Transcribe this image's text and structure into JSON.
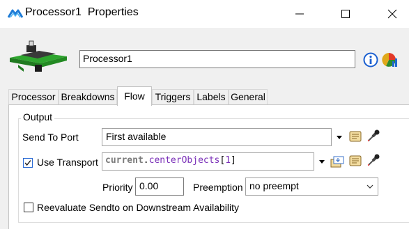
{
  "window": {
    "title": "Processor1  Properties",
    "icon": "flexsim-icon"
  },
  "header": {
    "object_name": "Processor1",
    "info_icon": "info-icon",
    "stats_icon": "statistics-icon"
  },
  "tabs": [
    {
      "label": "Processor",
      "active": false
    },
    {
      "label": "Breakdowns",
      "active": false
    },
    {
      "label": "Flow",
      "active": true
    },
    {
      "label": "Triggers",
      "active": false
    },
    {
      "label": "Labels",
      "active": false
    },
    {
      "label": "General",
      "active": false
    }
  ],
  "output": {
    "group_label": "Output",
    "send_to_port": {
      "label": "Send To Port",
      "value": "First available"
    },
    "use_transport": {
      "label": "Use Transport",
      "checked": true,
      "code_keyword": "current",
      "code_dot": ".",
      "code_member": "centerObjects",
      "code_open": "[",
      "code_index": "1",
      "code_close": "]"
    },
    "priority": {
      "label": "Priority",
      "value": "0.00"
    },
    "preemption": {
      "label": "Preemption",
      "value": "no preempt"
    },
    "reevaluate": {
      "label": "Reevaluate Sendto on Downstream Availability",
      "checked": false
    }
  },
  "colors": {
    "accent": "#2a6ad4",
    "info_blue": "#1a5fd0",
    "code_keyword": "#7a7a7a",
    "code_member": "#7a2fb8"
  }
}
